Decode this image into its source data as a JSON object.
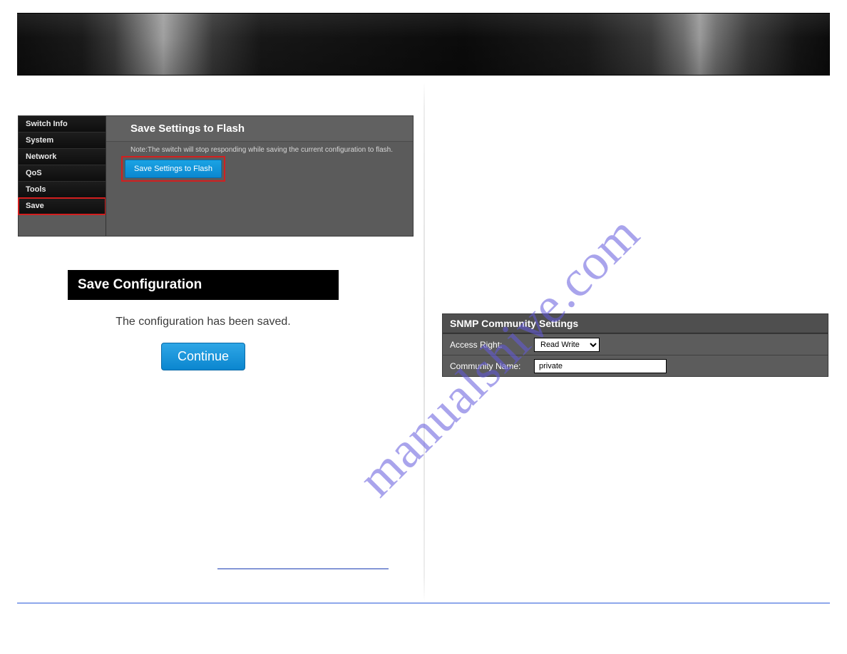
{
  "watermark": "manualshive.com",
  "sidebar": {
    "items": [
      {
        "label": "Switch Info"
      },
      {
        "label": "System"
      },
      {
        "label": "Network"
      },
      {
        "label": "QoS"
      },
      {
        "label": "Tools"
      },
      {
        "label": "Save"
      }
    ]
  },
  "save_panel": {
    "title": "Save Settings to Flash",
    "note": "Note:The switch will stop responding while saving the current configuration to flash.",
    "button_label": "Save Settings to Flash"
  },
  "dialog": {
    "title": "Save Configuration",
    "message": "The configuration has been saved.",
    "continue_label": "Continue"
  },
  "snmp": {
    "title": "SNMP Community Settings",
    "access_right_label": "Access Right:",
    "access_right_value": "Read Write",
    "community_name_label": "Community Name:",
    "community_name_value": "private"
  }
}
